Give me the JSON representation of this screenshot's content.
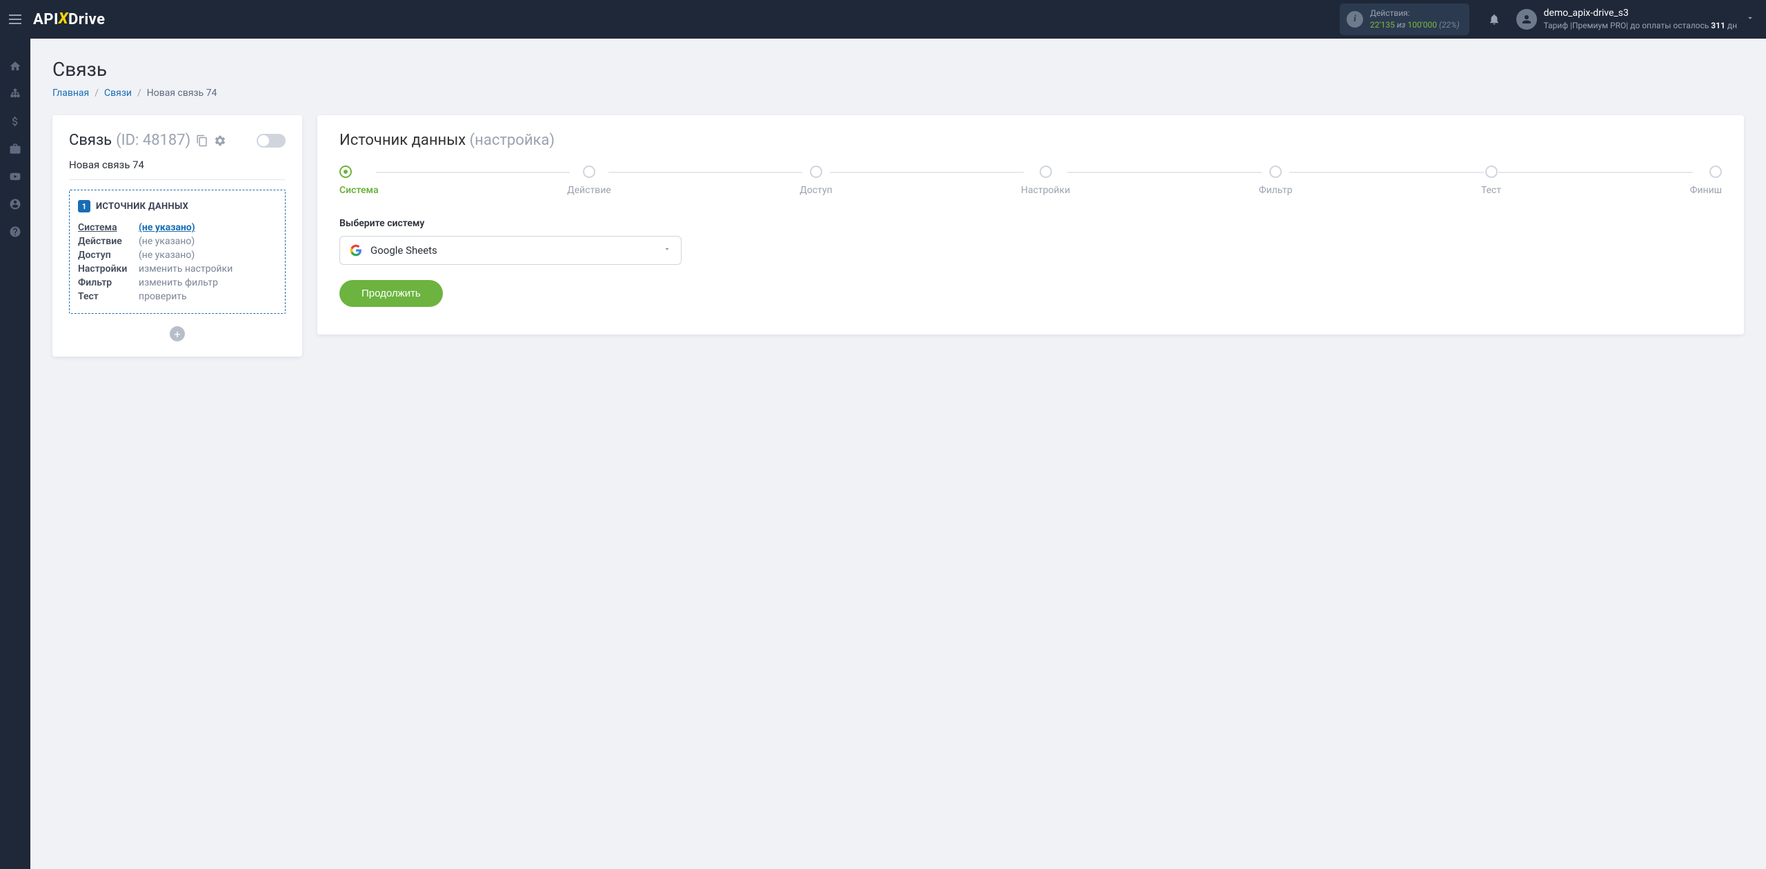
{
  "logo": {
    "pre": "API",
    "x": "X",
    "post": "Drive"
  },
  "header_actions": {
    "label": "Действия:",
    "used": "22'135",
    "sep": "из",
    "total": "100'000",
    "pct": "(22%)"
  },
  "user": {
    "name": "demo_apix-drive_s3",
    "tariff_pre": "Тариф |Премиум PRO| до оплаты осталось ",
    "days": "311",
    "tariff_post": " дн"
  },
  "page": {
    "title": "Связь"
  },
  "breadcrumb": {
    "home": "Главная",
    "links": "Связи",
    "current": "Новая связь 74"
  },
  "left_card": {
    "label": "Связь",
    "id": "(ID: 48187)",
    "name": "Новая связь 74",
    "source_num": "1",
    "source_title": "ИСТОЧНИК ДАННЫХ",
    "rows": {
      "system": {
        "key": "Система",
        "val": "(не указано)"
      },
      "action": {
        "key": "Действие",
        "val": "(не указано)"
      },
      "access": {
        "key": "Доступ",
        "val": "(не указано)"
      },
      "settings": {
        "key": "Настройки",
        "val": "изменить настройки"
      },
      "filter": {
        "key": "Фильтр",
        "val": "изменить фильтр"
      },
      "test": {
        "key": "Тест",
        "val": "проверить"
      }
    }
  },
  "right_card": {
    "title_main": "Источник данных ",
    "title_muted": "(настройка)",
    "steps": {
      "system": "Система",
      "action": "Действие",
      "access": "Доступ",
      "settings": "Настройки",
      "filter": "Фильтр",
      "test": "Тест",
      "finish": "Финиш"
    },
    "field_label": "Выберите систему",
    "select_value": "Google Sheets",
    "continue": "Продолжить"
  }
}
